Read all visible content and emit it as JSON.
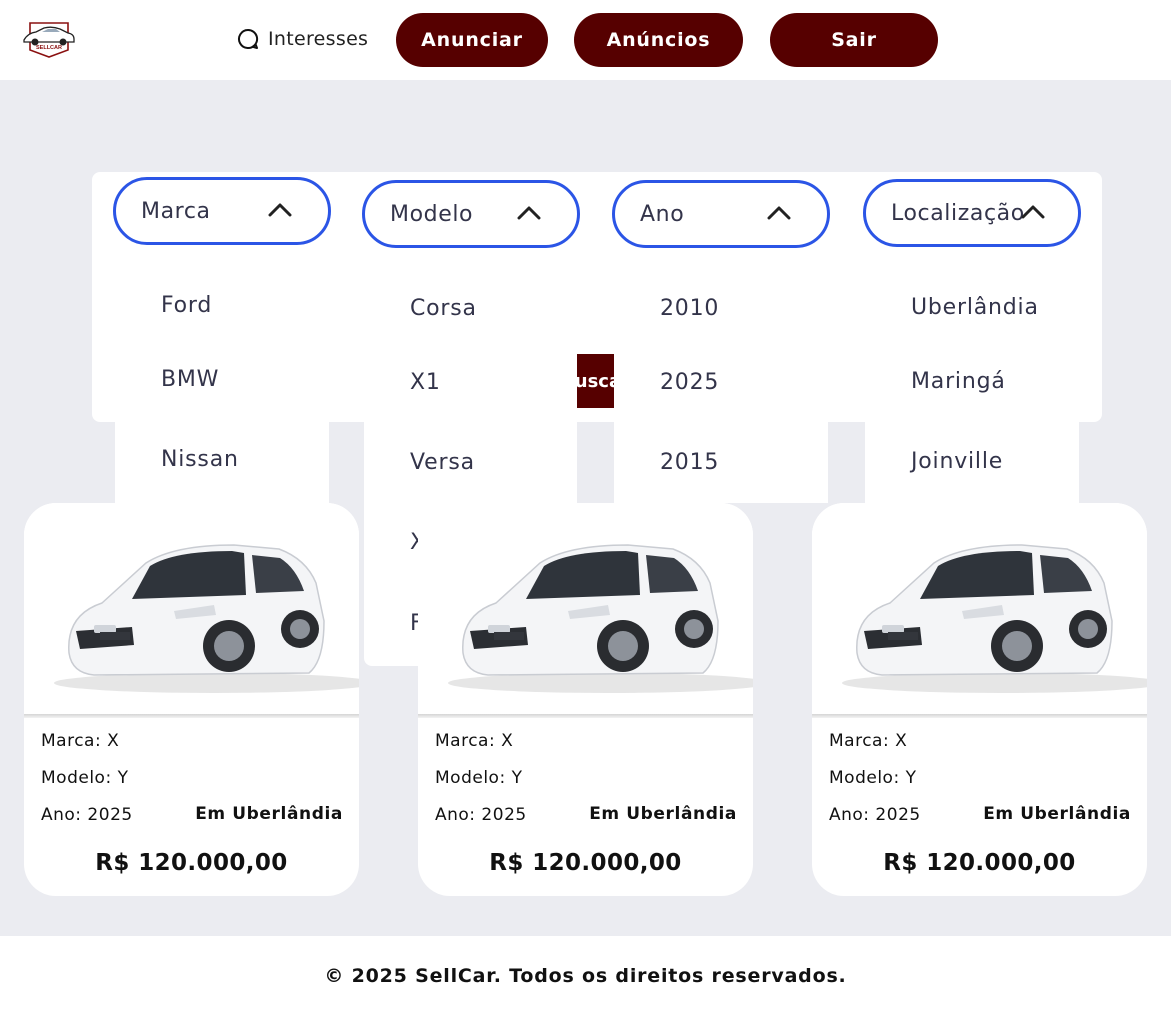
{
  "header": {
    "logo_text": "SELLCAR",
    "interesses_label": "Interesses",
    "buttons": [
      "Anunciar",
      "Anúncios",
      "Sair"
    ]
  },
  "filters": [
    {
      "label": "Marca",
      "options": [
        "Ford",
        "BMW",
        "Nissan"
      ]
    },
    {
      "label": "Modelo",
      "options": [
        "Corsa",
        "X1",
        "Versa",
        "X",
        "F"
      ]
    },
    {
      "label": "Ano",
      "options": [
        "2010",
        "2025",
        "2015"
      ]
    },
    {
      "label": "Localização",
      "options": [
        "Uberlândia",
        "Maringá",
        "Joinville"
      ]
    }
  ],
  "search_button": "Buscar",
  "cards": [
    {
      "marca": "Marca: X",
      "modelo": "Modelo: Y",
      "ano": "Ano: 2025",
      "local": "Em Uberlândia",
      "price": "R$ 120.000,00"
    },
    {
      "marca": "Marca: X",
      "modelo": "Modelo: Y",
      "ano": "Ano: 2025",
      "local": "Em Uberlândia",
      "price": "R$ 120.000,00"
    },
    {
      "marca": "Marca: X",
      "modelo": "Modelo: Y",
      "ano": "Ano: 2025",
      "local": "Em Uberlândia",
      "price": "R$ 120.000,00"
    }
  ],
  "footer": {
    "text": "© 2025 SellCar. Todos os direitos reservados."
  },
  "colors": {
    "accent": "#560000",
    "select_border": "#2b55e6",
    "background": "#ebecf1"
  }
}
